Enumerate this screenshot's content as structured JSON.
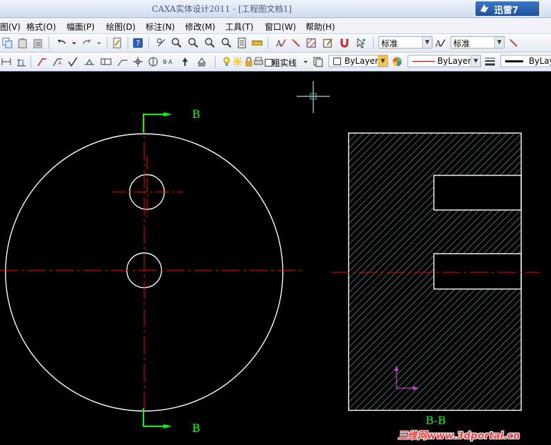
{
  "window": {
    "title": "CAXA实体设计2011 - [工程图文档1]"
  },
  "xunlei": {
    "label": "迅雷7"
  },
  "menu": {
    "items": [
      {
        "name": "view",
        "label": "图(V)"
      },
      {
        "name": "format",
        "label": "格式(O)"
      },
      {
        "name": "sheet",
        "label": "幅面(P)"
      },
      {
        "name": "draw",
        "label": "绘图(D)"
      },
      {
        "name": "dimension",
        "label": "标注(N)"
      },
      {
        "name": "modify",
        "label": "修改(M)"
      },
      {
        "name": "tools",
        "label": "工具(T)"
      },
      {
        "name": "window",
        "label": "窗口(W)"
      },
      {
        "name": "help",
        "label": "帮助(H)"
      }
    ]
  },
  "toolbar1": {
    "text_style": "标准",
    "dim_style": "标准"
  },
  "toolbar2": {
    "linetype_label": "粗实线",
    "layer_color": "ByLayer",
    "line_type": "ByLayer",
    "line_width": "ByLayer"
  },
  "drawing": {
    "section_label_top": "B",
    "section_label_bottom": "B",
    "section_view_label": "B-B"
  },
  "watermark": {
    "text": "三维网www.3dportal.cn"
  },
  "colors": {
    "canvas": "#000000",
    "geometry": "#ffffff",
    "centerline": "#ff0000",
    "section_marker": "#00ff00",
    "hatch": "#9fd0c8",
    "ucs": "#cc44cc"
  }
}
